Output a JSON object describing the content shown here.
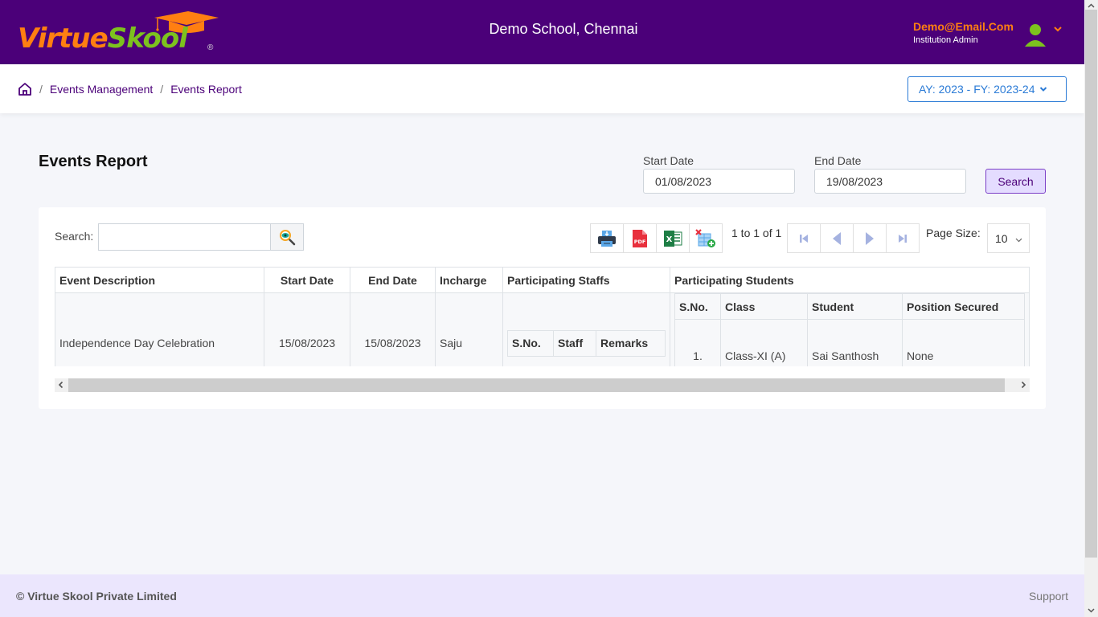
{
  "header": {
    "logo_part1": "Virtue",
    "logo_part2": "Skool",
    "logo_reg": "®",
    "school_name": "Demo School, Chennai",
    "user_email": "Demo@Email.Com",
    "user_role": "Institution Admin"
  },
  "breadcrumb": {
    "items": [
      {
        "label": "Events Management"
      },
      {
        "label": "Events Report"
      }
    ],
    "separator": "/"
  },
  "academic_year": {
    "selected": "AY: 2023 - FY: 2023-24"
  },
  "page": {
    "title": "Events Report"
  },
  "filters": {
    "start_date_label": "Start Date",
    "start_date_value": "01/08/2023",
    "end_date_label": "End Date",
    "end_date_value": "19/08/2023",
    "search_button": "Search"
  },
  "grid": {
    "search_label": "Search:",
    "search_value": "",
    "pager_info": "1 to 1 of 1",
    "page_size_label": "Page Size:",
    "page_size_value": "10",
    "export_icons": [
      "print-icon",
      "pdf-icon",
      "excel-icon",
      "column-chooser-icon"
    ],
    "pager_icons": [
      "first-page-icon",
      "prev-page-icon",
      "next-page-icon",
      "last-page-icon"
    ],
    "columns": [
      "Event Description",
      "Start Date",
      "End Date",
      "Incharge",
      "Participating Staffs",
      "Participating Students"
    ],
    "rows": [
      {
        "event_description": "Independence Day Celebration",
        "start_date": "15/08/2023",
        "end_date": "15/08/2023",
        "incharge": "Saju",
        "staff_columns": [
          "S.No.",
          "Staff",
          "Remarks"
        ],
        "staff_rows": [],
        "student_columns": [
          "S.No.",
          "Class",
          "Student",
          "Position Secured"
        ],
        "student_rows": [
          {
            "sno": "1.",
            "class": "Class-XI (A)",
            "student": "Sai Santhosh",
            "position": "None"
          }
        ]
      }
    ]
  },
  "footer": {
    "copyright": "© Virtue Skool Private Limited",
    "support": "Support"
  },
  "colors": {
    "brand_purple": "#4b0079",
    "brand_orange": "#ff7f11",
    "brand_green": "#7dc21e",
    "link_blue": "#2b7bd6",
    "footer_bg": "#ebe6fd"
  }
}
